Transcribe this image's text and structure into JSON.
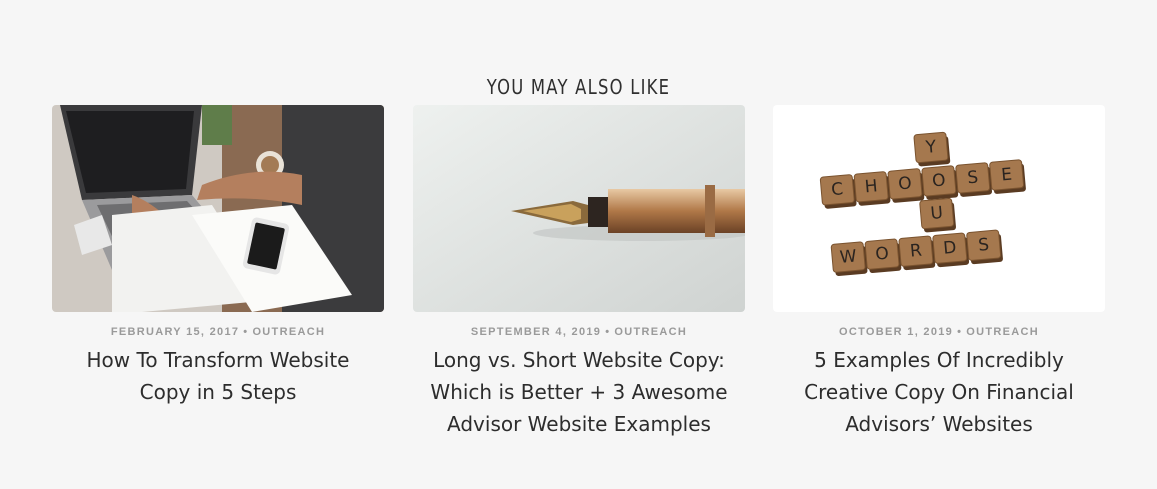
{
  "section": {
    "heading": "YOU MAY ALSO LIKE"
  },
  "posts": [
    {
      "image_label": "person typing on laptop with phone and notebook",
      "date": "FEBRUARY 15, 2017",
      "separator": "•",
      "category": "OUTREACH",
      "title": "How To Transform Website Copy in 5 Steps"
    },
    {
      "image_label": "fountain pen nib",
      "date": "SEPTEMBER 4, 2019",
      "separator": "•",
      "category": "OUTREACH",
      "title": "Long vs. Short Website Copy: Which is Better + 3 Awesome Advisor Website Examples"
    },
    {
      "image_label": "scrabble tiles spelling CHOOSE YOUR WORDS",
      "date": "OCTOBER 1, 2019",
      "separator": "•",
      "category": "OUTREACH",
      "title": "5 Examples Of Incredibly Creative Copy On Financial Advisors’ Websites"
    }
  ],
  "tiles": {
    "choose": [
      "C",
      "H",
      "O",
      "O",
      "S",
      "E"
    ],
    "you": [
      "Y",
      "O",
      "U"
    ],
    "words": [
      "W",
      "O",
      "R",
      "D",
      "S"
    ]
  }
}
